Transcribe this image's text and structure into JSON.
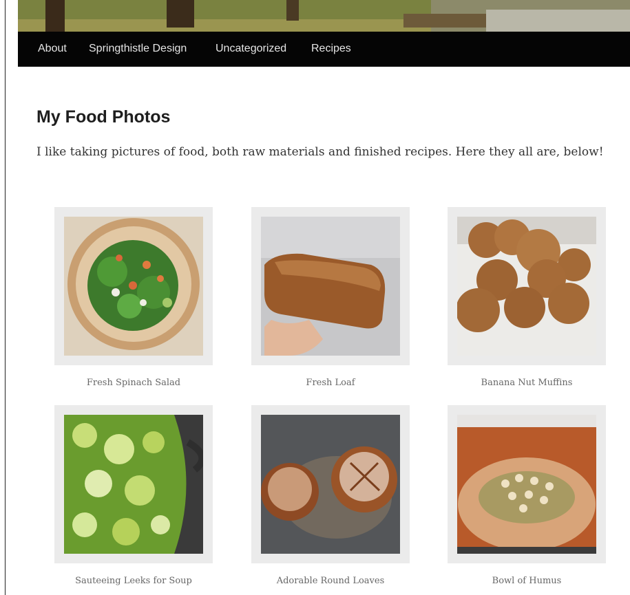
{
  "nav": {
    "items": [
      {
        "label": "About"
      },
      {
        "label": "Springthistle Design"
      },
      {
        "label": "Uncategorized"
      },
      {
        "label": "Recipes"
      }
    ]
  },
  "page": {
    "title": "My Food Photos",
    "intro": "I like taking pictures of food, both raw materials and finished recipes. Here they all are, below!"
  },
  "gallery": {
    "items": [
      {
        "caption": "Fresh Spinach Salad",
        "icon": "salad-photo"
      },
      {
        "caption": "Fresh Loaf",
        "icon": "bread-loaf-photo"
      },
      {
        "caption": "Banana Nut Muffins",
        "icon": "muffins-photo"
      },
      {
        "caption": "Sauteeing Leeks for Soup",
        "icon": "leeks-pot-photo"
      },
      {
        "caption": "Adorable Round Loaves",
        "icon": "round-loaves-photo"
      },
      {
        "caption": "Bowl of Humus",
        "icon": "hummus-bowl-photo"
      }
    ]
  },
  "colors": {
    "nav_background": "#050505",
    "nav_text": "#e6e6e6",
    "thumb_frame": "#ebebeb",
    "caption_text": "#666666"
  }
}
